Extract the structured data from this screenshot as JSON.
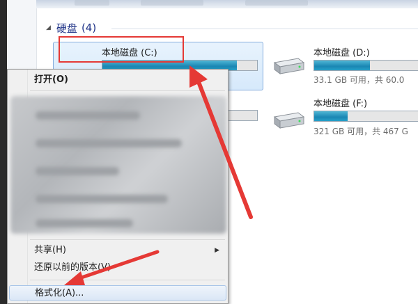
{
  "group": {
    "arrow": "◢",
    "title": "硬盘",
    "count": "(4)"
  },
  "drives": [
    {
      "name": "本地磁盘 (C:)",
      "used_fraction": 0.87,
      "meta": "",
      "selected": true
    },
    {
      "name": "本地磁盘 (D:)",
      "used_fraction": 0.5,
      "meta": "33.1 GB 可用，共 60.0"
    },
    {
      "name": "",
      "used_fraction": 0.0,
      "meta": ""
    },
    {
      "name": "本地磁盘 (F:)",
      "used_fraction": 0.3,
      "meta": "321 GB 可用，共 467 G"
    }
  ],
  "context_menu": {
    "open": "打开(O)",
    "share": "共享(H)",
    "restore": "还原以前的版本(V)",
    "format": "格式化(A)...",
    "submenu_arrow": "▶"
  },
  "colors": {
    "annotation_red": "#e53935",
    "bar_fill": "#1a86b3",
    "group_title": "#1e3287"
  }
}
